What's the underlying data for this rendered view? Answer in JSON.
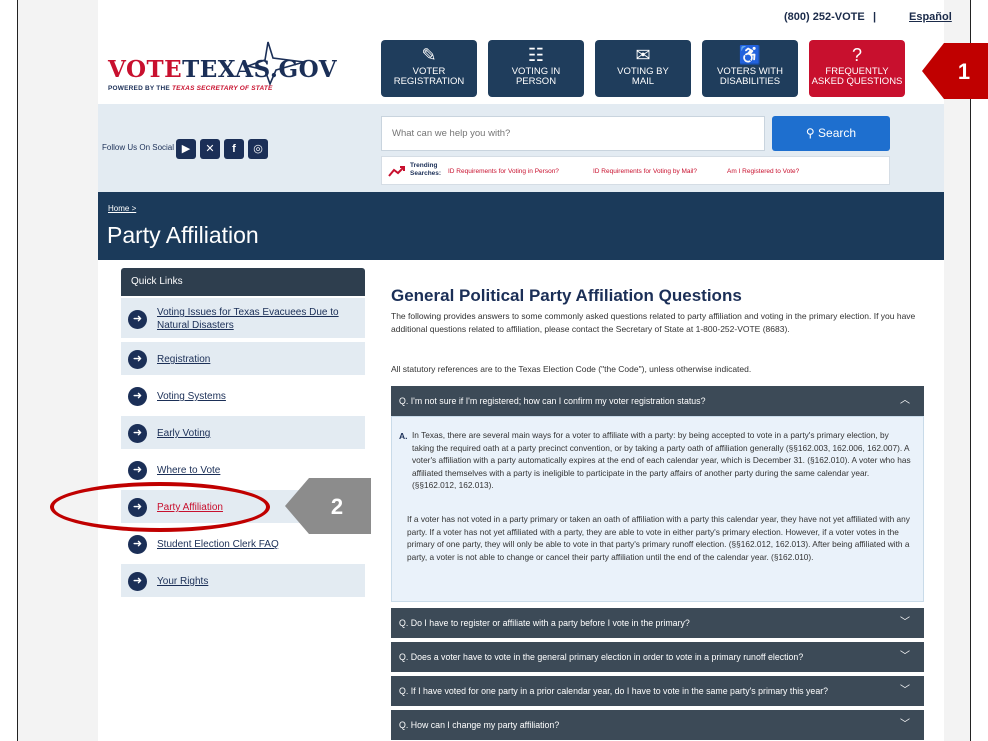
{
  "topbar": {
    "phone": "(800) 252-VOTE",
    "separator": "|",
    "language_link": "Español"
  },
  "logo": {
    "vote": "VOTE",
    "texas": "TEXAS.GOV",
    "powered": "POWERED BY THE",
    "sos": "TEXAS SECRETARY OF STATE"
  },
  "nav": [
    {
      "label1": "VOTER",
      "label2": "REGISTRATION",
      "icon": "edit-icon"
    },
    {
      "label1": "VOTING IN",
      "label2": "PERSON",
      "icon": "ballot-icon"
    },
    {
      "label1": "VOTING BY",
      "label2": "MAIL",
      "icon": "mail-icon"
    },
    {
      "label1": "VOTERS WITH",
      "label2": "DISABILITIES",
      "icon": "accessibility-icon"
    },
    {
      "label1": "FREQUENTLY",
      "label2": "ASKED QUESTIONS",
      "icon": "question-icon"
    }
  ],
  "social": {
    "label": "Follow Us On Social"
  },
  "search": {
    "placeholder": "What can we help you with?",
    "button": "Search"
  },
  "trending": {
    "label1": "Trending",
    "label2": "Searches:",
    "items": [
      "ID Requirements for Voting in Person?",
      "ID Requirements for Voting by Mail?",
      "Am I Registered to Vote?"
    ]
  },
  "breadcrumb": {
    "home": "Home >"
  },
  "page_title": "Party Affiliation",
  "quick_links": {
    "title": "Quick Links",
    "items": [
      {
        "label": "Voting Issues for Texas Evacuees Due to Natural Disasters"
      },
      {
        "label": "Registration"
      },
      {
        "label": "Voting Systems"
      },
      {
        "label": "Early Voting"
      },
      {
        "label": "Where to Vote"
      },
      {
        "label": "Party Affiliation"
      },
      {
        "label": "Student Election Clerk FAQ"
      },
      {
        "label": "Your Rights"
      }
    ]
  },
  "main": {
    "heading": "General Political Party Affiliation Questions",
    "intro": "The following provides answers to some commonly asked questions related to party affiliation and voting in the primary election. If you have additional questions related to affiliation, please contact the Secretary of State at 1-800-252-VOTE (8683).",
    "statutory": "All statutory references are to the Texas Election Code (\"the Code\"), unless otherwise indicated.",
    "faq": [
      {
        "q": "Q. I'm not sure if I'm registered; how can I confirm my voter registration status?"
      },
      {
        "q": "Q. Do I have to register or affiliate with a party before I vote in the primary?"
      },
      {
        "q": "Q. Does a voter have to vote in the general primary election in order to vote in a primary runoff election?"
      },
      {
        "q": "Q. If I have voted for one party in a prior calendar year, do I have to vote in the same party's primary this year?"
      },
      {
        "q": "Q. How can I change my party affiliation?"
      }
    ],
    "answer_label": "A.",
    "answer_p1": "In Texas, there are several main ways for a voter to affiliate with a party: by being accepted to vote in a party's primary election, by taking the required oath at a party precinct convention, or by taking a party oath of affiliation generally (§§162.003, 162.006, 162.007). A voter's affiliation with a party automatically expires at the end of each calendar year, which is December 31. (§162.010). A voter who has affiliated themselves with a party is ineligible to participate in the party affairs of another party during the same calendar year. (§§162.012, 162.013).",
    "answer_p2": "If a voter has not voted in a party primary or taken an oath of affiliation with a party this calendar year, they have not yet affiliated with any party. If a voter has not yet affiliated with a party, they are able to vote in either party's primary election. However, if a voter votes in the primary of one party, they will only be able to vote in that party's primary runoff election. (§§162.012, 162.013). After being affiliated with a party, a voter is not able to change or cancel their party affiliation until the end of the calendar year. (§162.010)."
  },
  "callouts": {
    "one": "1",
    "two": "2"
  },
  "colors": {
    "navy": "#1b2f57",
    "red": "#c8102e",
    "accordion": "#3c4a57",
    "callout_red": "#c00000"
  }
}
